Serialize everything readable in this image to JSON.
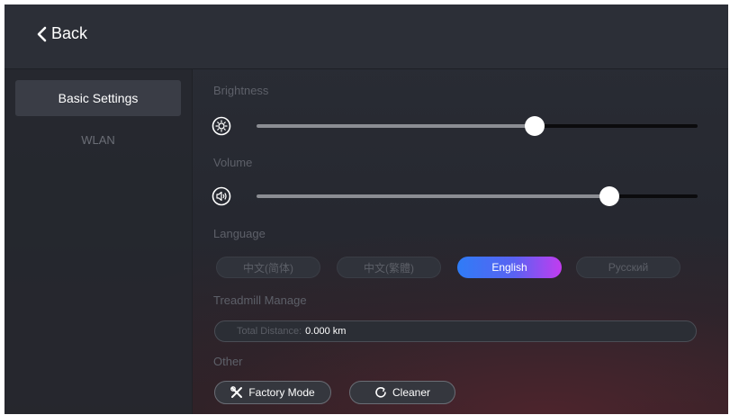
{
  "header": {
    "back_label": "Back"
  },
  "sidebar": {
    "items": [
      {
        "label": "Basic Settings",
        "active": true
      },
      {
        "label": "WLAN",
        "active": false
      }
    ]
  },
  "settings": {
    "brightness": {
      "label": "Brightness",
      "icon": "brightness-icon",
      "value": 0.63
    },
    "volume": {
      "label": "Volume",
      "icon": "volume-icon",
      "value": 0.8
    },
    "language": {
      "label": "Language",
      "options": [
        "中文(简体)",
        "中文(繁體)",
        "English",
        "Русский"
      ],
      "selected": "English"
    },
    "treadmill": {
      "label": "Treadmill Manage",
      "distance_key": "Total Distance:",
      "distance_value": "0.000 km"
    },
    "other": {
      "label": "Other",
      "factory_mode": "Factory Mode",
      "cleaner": "Cleaner"
    }
  },
  "colors": {
    "accent_gradient_start": "#2f7cf6",
    "accent_gradient_end": "#c23cf0",
    "background": "#262830"
  }
}
